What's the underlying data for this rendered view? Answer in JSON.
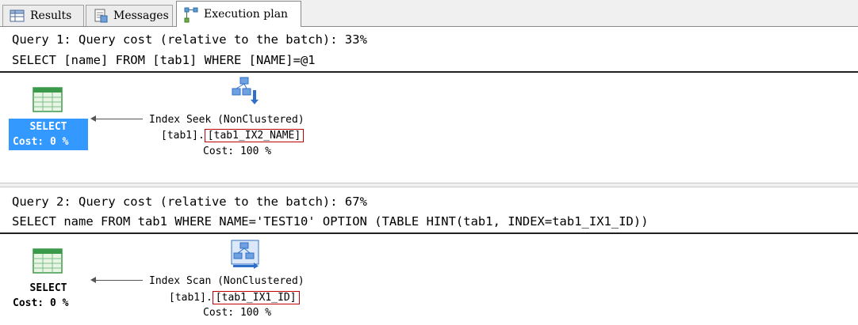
{
  "tabs": [
    {
      "label": "Results",
      "icon": "grid-icon",
      "active": false
    },
    {
      "label": "Messages",
      "icon": "messages-icon",
      "active": false
    },
    {
      "label": "Execution plan",
      "icon": "execution-plan-icon",
      "active": true
    }
  ],
  "queries": [
    {
      "header": "Query 1: Query cost (relative to the batch): 33%",
      "sql": "SELECT [name] FROM [tab1] WHERE [NAME]=@1",
      "select_label": "SELECT",
      "select_cost": "Cost: 0 %",
      "select_selected": true,
      "operator_title": "Index Seek (NonClustered)",
      "operator_table": "[tab1].",
      "operator_index": "[tab1_IX2_NAME]",
      "operator_cost": "Cost: 100 %",
      "operator_icon": "index-seek-icon"
    },
    {
      "header": "Query 2: Query cost (relative to the batch): 67%",
      "sql": "SELECT name FROM tab1 WHERE NAME='TEST10' OPTION (TABLE HINT(tab1, INDEX=tab1_IX1_ID))",
      "select_label": "SELECT",
      "select_cost": "Cost: 0 %",
      "select_selected": false,
      "operator_title": "Index Scan (NonClustered)",
      "operator_table": "[tab1].",
      "operator_index": "[tab1_IX1_ID]",
      "operator_cost": "Cost: 100 %",
      "operator_icon": "index-scan-icon"
    }
  ],
  "colors": {
    "selection": "#3399ff",
    "highlight_box": "#c00000",
    "icon_green": "#3a9a4a",
    "icon_blue": "#2f6fc9"
  }
}
